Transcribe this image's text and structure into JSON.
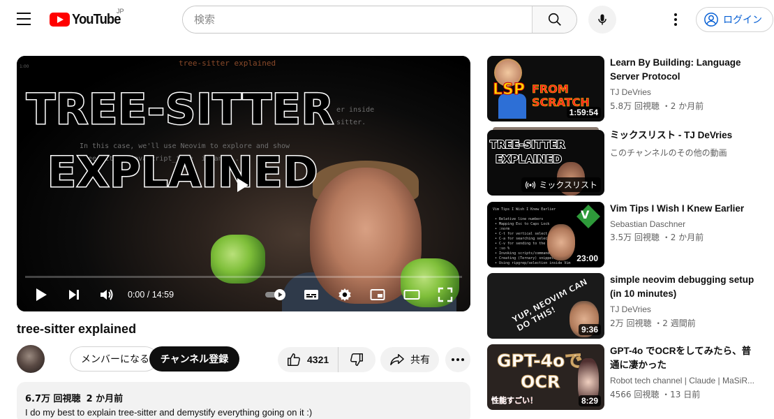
{
  "header": {
    "logo_text": "YouTube",
    "region": "JP",
    "search_placeholder": "検索",
    "login_label": "ログイン"
  },
  "player": {
    "overlay_line1": "TREE-SITTER",
    "overlay_line2": "EXPLAINED",
    "code_top": "tree-sitter explained",
    "code_line1": "er inside",
    "code_line2": "sitter.",
    "code_line3": "In this case, we'll use Neovim to explore and show",
    "code_line4": "tree-sitter_javascript_tree  in and ...",
    "time": "0:00 / 14:59",
    "progress_fraction": 0.0
  },
  "video": {
    "title": "tree-sitter explained",
    "member_label": "メンバーになる",
    "subscribe_label": "チャンネル登録",
    "like_count": "4321",
    "share_label": "共有",
    "views": "6.7万 回視聴",
    "age": "2 か月前",
    "description": "I do my best to explain tree-sitter and demystify everything going on it :)"
  },
  "recommendations": [
    {
      "title": "Learn By Building: Language Server Protocol",
      "channel": "TJ DeVries",
      "meta": "5.8万 回視聴 ・2 か月前",
      "duration": "1:59:54",
      "thumb_text_1": "LSP",
      "thumb_text_2": "FROM SCRATCH"
    },
    {
      "title": "ミックスリスト - TJ DeVries",
      "channel": "このチャンネルのその他の動画",
      "badge": "ミックスリスト",
      "thumb_text_1": "TREE-SITTER",
      "thumb_text_2": "EXPLAINED"
    },
    {
      "title": "Vim Tips I Wish I Knew Earlier",
      "channel": "Sebastian Daschner",
      "meta": "3.5万 回視聴 ・2 か月前",
      "duration": "23:00",
      "thumb_code": "Vim Tips I Wish I Knew Earlier\n\n • Relative line numbers\n • Mapping Esc to Caps Lock\n • :norm\n • C-t for vertical select mode\n • C-a for searching selections\n • C-v for sending to the terminal\n • :so %\n • Invoking scripts/commands\n • Creating (Ternary) snippets\n • Using ripgrep/selection inside Vim",
      "thumb_logo": "V"
    },
    {
      "title": "simple neovim debugging setup (in 10 minutes)",
      "channel": "TJ DeVries",
      "meta": "2万 回視聴 ・2 週間前",
      "duration": "9:36",
      "thumb_text_1": "YUP, NEOVIM CAN DO THIS!"
    },
    {
      "title": "GPT-4o でOCRをしてみたら、普通に凄かった",
      "channel": "Robot tech channel | Claude | MaSiR...",
      "meta": "4566 回視聴 ・13 日前",
      "duration": "8:29",
      "thumb_text_1": "GPT-4oで",
      "thumb_text_2": "OCR",
      "thumb_text_3": "性能すごい！"
    }
  ],
  "icons": {
    "menu": "hamburger-icon",
    "search": "search-icon",
    "mic": "microphone-icon",
    "account": "account-icon",
    "like": "thumbs-up-icon",
    "dislike": "thumbs-down-icon",
    "share": "share-arrow-icon"
  },
  "colors": {
    "brand_red": "#ff0000",
    "link_blue": "#065fd4",
    "text_primary": "#0f0f0f",
    "text_secondary": "#606060",
    "chip_bg": "#f2f2f2"
  }
}
